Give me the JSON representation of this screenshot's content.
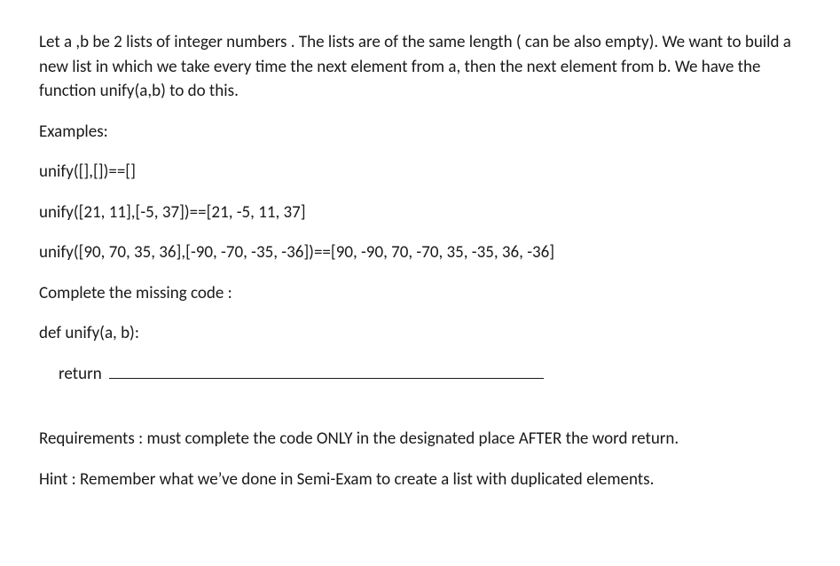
{
  "intro": "Let a ,b be 2 lists of integer numbers . The lists are of the same length ( can be also empty). We want to build a new list in which we take every time the next element from a, then the next element from b. We have the function unify(a,b) to do this.",
  "examples_heading": "Examples:",
  "examples": [
    "unify([],[])==[]",
    "unify([21, 11],[-5, 37])==[21, -5, 11, 37]",
    "unify([90, 70, 35, 36],[-90, -70, -35, -36])==[90, -90, 70, -70, 35, -35, 36, -36]"
  ],
  "complete_prompt": "Complete the missing code :",
  "code_def": "def unify(a, b):",
  "code_return": "return",
  "requirements": "Requirements : must complete the code ONLY in the designated place AFTER the word return.",
  "hint": "Hint : Remember what we’ve done in Semi-Exam to create a list with duplicated elements."
}
